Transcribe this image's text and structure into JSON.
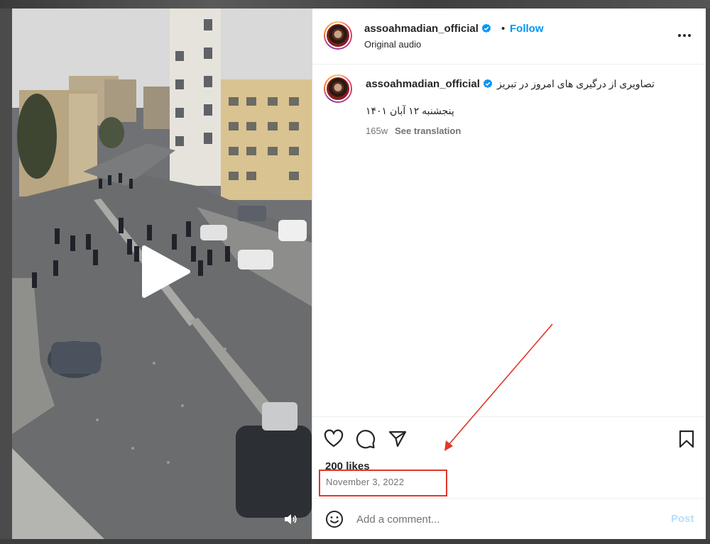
{
  "header": {
    "username": "assoahmadian_official",
    "separator": "•",
    "follow_label": "Follow",
    "audio_label": "Original audio"
  },
  "caption": {
    "username": "assoahmadian_official",
    "text": "تصاویری از درگیری های امروز در تبریز",
    "line2": "پنجشنبه ۱۲ آبان ۱۴۰۱",
    "age": "165w",
    "translate_label": "See translation"
  },
  "stats": {
    "likes": "200 likes",
    "date": "November 3, 2022"
  },
  "comment": {
    "placeholder": "Add a comment...",
    "post_label": "Post"
  },
  "icons": {
    "like": "heart-icon",
    "comment": "comment-icon",
    "share": "share-icon",
    "save": "bookmark-icon",
    "more": "more-horizontal-icon",
    "emoji": "emoji-icon",
    "verified": "verified-badge-icon",
    "play": "play-icon",
    "volume": "volume-icon"
  },
  "colors": {
    "accent": "#0095f6",
    "post_disabled": "#b2dffc",
    "annotation": "#e0372b",
    "secondary_text": "#737373"
  }
}
